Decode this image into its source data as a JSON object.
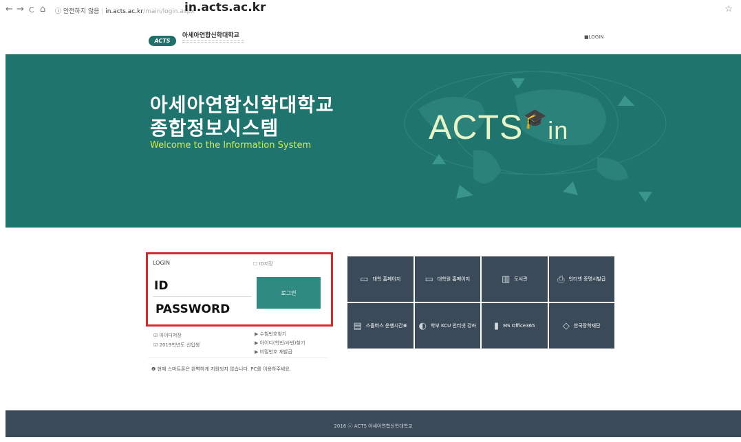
{
  "browser": {
    "back_icon": "←",
    "forward_icon": "→",
    "reload_icon": "C",
    "home_icon": "⌂",
    "security_text": "ⓘ 안전하지 않음",
    "url_host": "in.acts.ac.kr",
    "url_path": "/main/login.aspx",
    "overlay_text": "in.acts.ac.kr",
    "star_icon": "☆"
  },
  "header": {
    "logo_badge": "ACTS",
    "logo_name": "아세아연합신학대학교",
    "login_link": "LOGIN"
  },
  "hero": {
    "title_line1": "아세아연합신학대학교",
    "title_line2": "종합정보시스템",
    "welcome": "Welcome to the Information System",
    "mark_text": "ACTS",
    "mark_suffix": "in"
  },
  "login": {
    "label": "LOGIN",
    "save_id": "ID저장",
    "id_value": "ID",
    "password_value": "PASSWORD",
    "button": "로그인",
    "options_left": [
      "아이디저장",
      "2019학년도 신입생"
    ],
    "options_right": [
      "수험번호찾기",
      "아이디(학번/사번)찾기",
      "비밀번호 재발급"
    ],
    "notice": "현재 스마트폰은 완벽하게 지원되지 않습니다. PC를 이용하주세요."
  },
  "tiles": [
    {
      "label": "대학 홈페이지",
      "icon": "monitor-icon"
    },
    {
      "label": "대학원 홈페이지",
      "icon": "monitor-icon"
    },
    {
      "label": "도서관",
      "icon": "book-icon"
    },
    {
      "label": "인터넷 증명서발급",
      "icon": "printer-icon"
    },
    {
      "label": "스몰버스 운행시간표",
      "icon": "bus-icon"
    },
    {
      "label": "학부 KCU 인터넷 강좌",
      "icon": "mouse-icon"
    },
    {
      "label": "MS Office365",
      "icon": "office-icon"
    },
    {
      "label": "한국장학재단",
      "icon": "graduation-icon"
    }
  ],
  "footer": {
    "text": "2016 ⓒ ACTS 아세아연합신학대학교"
  },
  "colors": {
    "hero_bg": "#1f756e",
    "hero_accent": "#d6e94a",
    "tile_bg": "#3a4a58",
    "button_bg": "#2f8a82",
    "highlight": "#d22a2a"
  }
}
